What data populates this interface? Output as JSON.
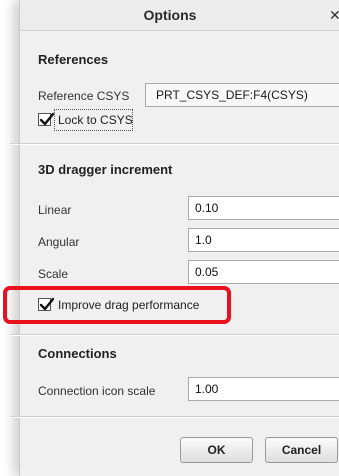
{
  "dialog": {
    "title": "Options",
    "close_glyph": "✕"
  },
  "references": {
    "title": "References",
    "csys_label": "Reference CSYS",
    "csys_value": "PRT_CSYS_DEF:F4(CSYS)",
    "lock_label": "Lock to CSYS",
    "lock_checked": true
  },
  "dragger": {
    "title": "3D dragger increment",
    "linear_label": "Linear",
    "linear_value": "0.10",
    "angular_label": "Angular",
    "angular_value": "1.0",
    "scale_label": "Scale",
    "scale_value": "0.05",
    "improve_label": "Improve drag performance",
    "improve_checked": true
  },
  "connections": {
    "title": "Connections",
    "icon_scale_label": "Connection icon scale",
    "icon_scale_value": "1.00"
  },
  "buttons": {
    "ok": "OK",
    "cancel": "Cancel"
  },
  "colors": {
    "highlight": "#e8111d",
    "dialog_bg": "#f0f0f0"
  },
  "icons": {
    "checkbox_check": "checkmark-icon",
    "close": "close-icon"
  }
}
